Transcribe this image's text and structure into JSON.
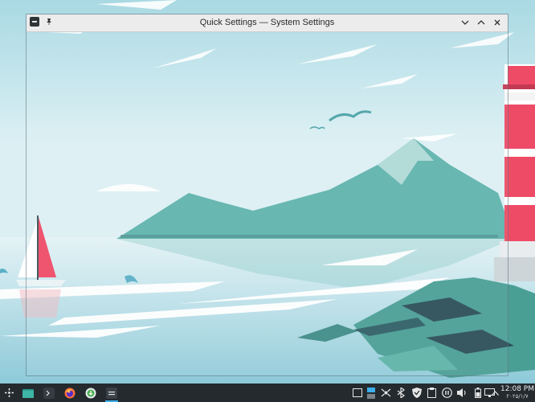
{
  "window": {
    "title": "Quick Settings — System Settings",
    "icon": "system-settings-icon",
    "controls": [
      "minimize",
      "maximize",
      "close"
    ]
  },
  "taskbar": {
    "launcher": "application-launcher-icon",
    "tasks": [
      {
        "name": "file-manager-icon"
      },
      {
        "name": "terminal-icon"
      },
      {
        "name": "firefox-icon"
      },
      {
        "name": "software-center-icon"
      },
      {
        "name": "system-settings-icon",
        "active": true
      }
    ],
    "tray": [
      "desktop-icon",
      "virtual-desktop-icon",
      "network-icon",
      "bluetooth-icon",
      "security-icon",
      "clipboard-icon",
      "media-icon",
      "volume-icon",
      "battery-icon",
      "display-icon",
      "expand-icon"
    ],
    "clock": {
      "time": "12:08 PM",
      "date": "۲۰۲۵/۱/۷"
    }
  },
  "colors": {
    "sky": "#bfe3ea",
    "water": "#d8eef2",
    "mountain": "#5fb3ad",
    "lighthouse_red": "#ee4b66",
    "taskbar": "#242a2e",
    "titlebar": "#ececec",
    "accent": "#3daee9"
  }
}
